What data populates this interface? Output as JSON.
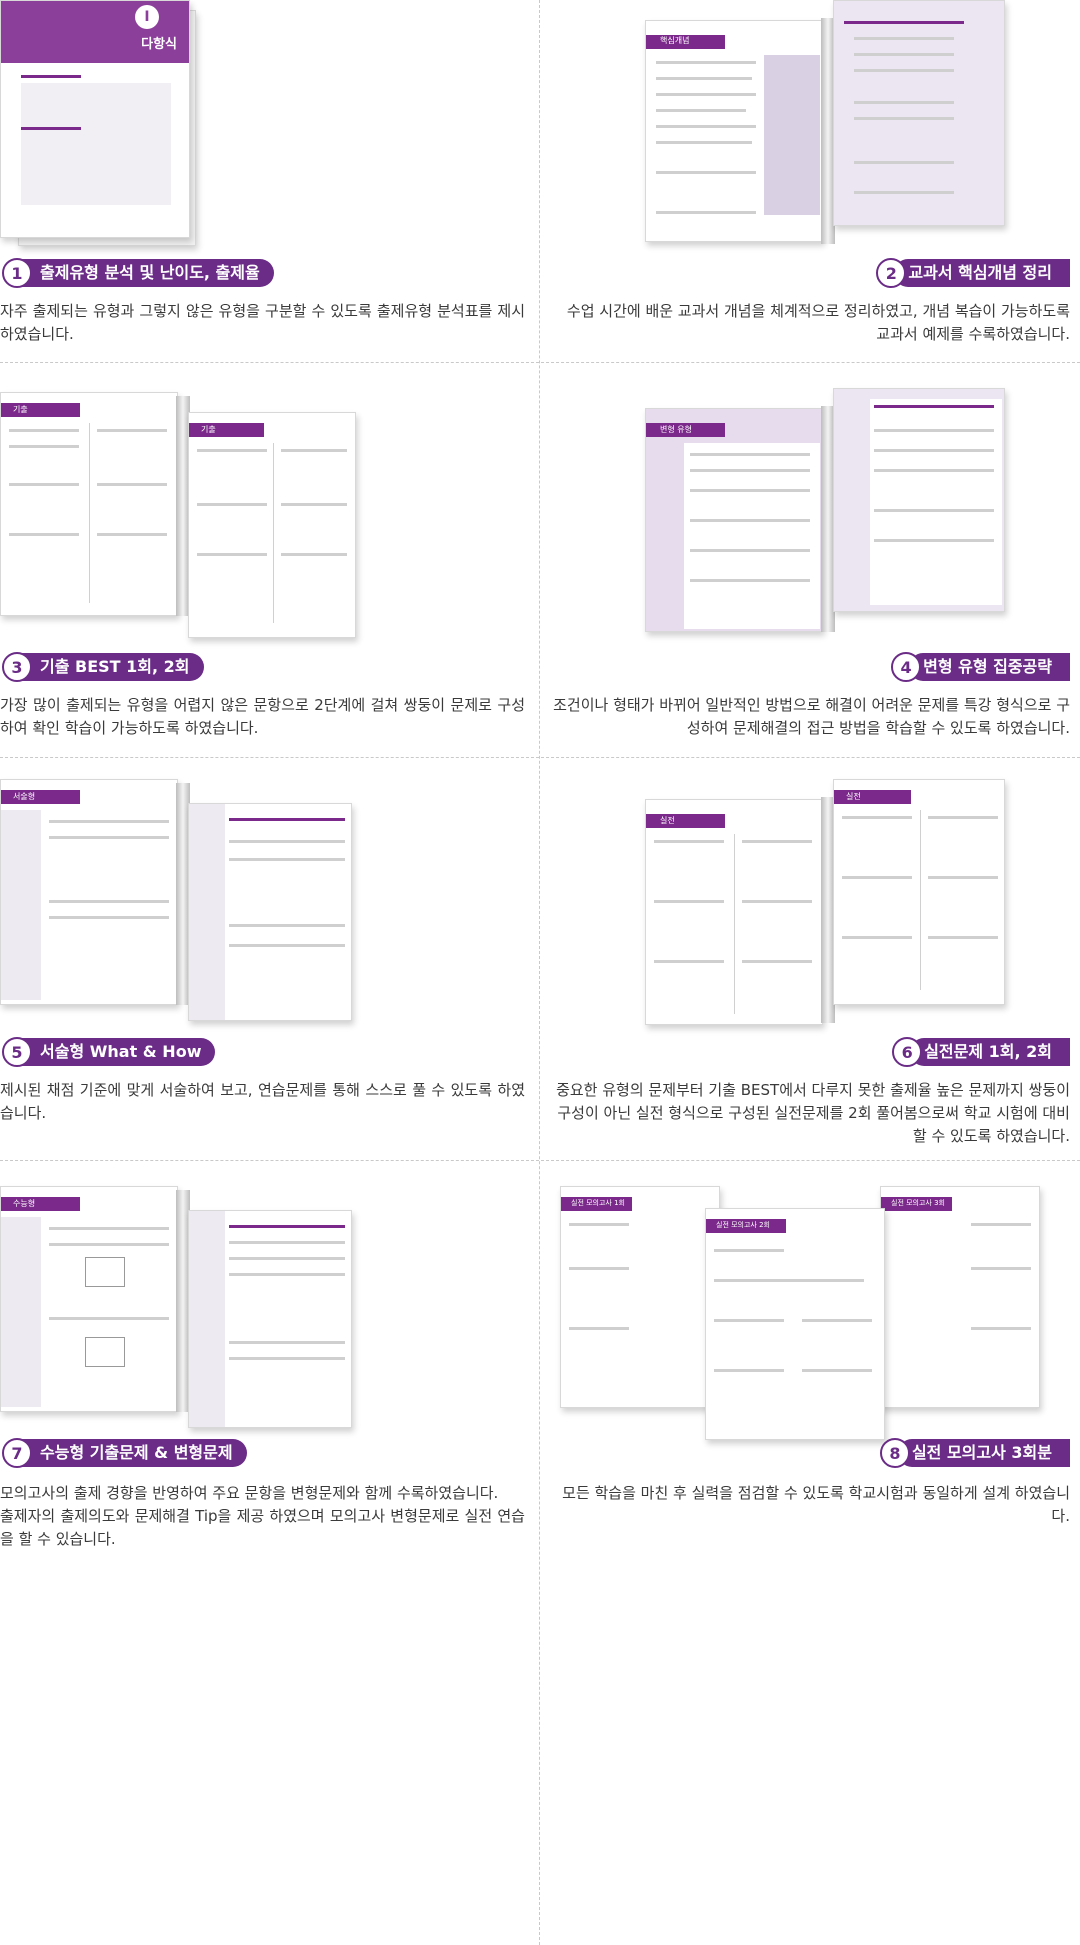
{
  "items": [
    {
      "num": "1",
      "title": "출제유형 분석 및 난이도, 출제율",
      "desc": [
        "자주 출제되는 유형과 그렇지 않은 유형을 구분할 수 있도록 출제유형 분석표를 제시하였습니다."
      ]
    },
    {
      "num": "2",
      "title": "교과서 핵심개념 정리",
      "desc": [
        "수업 시간에 배운 교과서 개념을 체계적으로 정리하였고, 개념 복습이 가능하도록 교과서 예제를 수록하였습니다."
      ]
    },
    {
      "num": "3",
      "title": "기출 BEST 1회, 2회",
      "desc": [
        "가장 많이 출제되는 유형을 어렵지 않은 문항으로 2단계에 걸쳐 쌍둥이 문제로 구성하여 확인 학습이 가능하도록 하였습니다."
      ]
    },
    {
      "num": "4",
      "title": "변형 유형 집중공략",
      "desc": [
        "조건이나 형태가 바뀌어 일반적인 방법으로 해결이 어려운 문제를 특강 형식으로 구성하여 문제해결의 접근 방법을 학습할 수 있도록 하였습니다."
      ]
    },
    {
      "num": "5",
      "title": "서술형 What & How",
      "desc": [
        "제시된 채점 기준에 맞게 서술하여 보고, 연습문제를 통해 스스로 풀 수 있도록 하였습니다."
      ]
    },
    {
      "num": "6",
      "title": "실전문제 1회, 2회",
      "desc": [
        "중요한 유형의 문제부터 기출 BEST에서 다루지 못한 출제율 높은 문제까지 쌍둥이 구성이 아닌 실전 형식으로 구성된 실전문제를 2회 풀어봄으로써 학교 시험에 대비할 수 있도록 하였습니다."
      ]
    },
    {
      "num": "7",
      "title": "수능형 기출문제 & 변형문제",
      "desc": [
        "모의고사의 출제 경향을 반영하여 주요 문항을 변형문제와 함께 수록하였습니다.",
        "출제자의 출제의도와 문제해결 Tip을 제공 하였으며 모의고사 변형문제로 실전 연습을 할 수 있습니다."
      ]
    },
    {
      "num": "8",
      "title": "실전 모의고사 3회분",
      "desc": [
        "모든 학습을 마친 후 실력을 점검할 수 있도록 학교시험과 동일하게 설계 하였습니다."
      ]
    }
  ],
  "thumbnails": {
    "cover_numeral": "I",
    "cover_title": "다항식",
    "concept_header": "핵심개념",
    "best1_header": "기출",
    "best2_header": "기출",
    "variant_header": "변형 유형",
    "essay_header": "서술형",
    "practice1_header": "실전",
    "practice2_header": "실전",
    "suneung_header": "수능형",
    "mock_headers": [
      "실전 모의고사 1회",
      "실전 모의고사 2회",
      "실전 모의고사 3회"
    ]
  },
  "colors": {
    "accent": "#6a2c86",
    "accent_light": "#8c3e9b",
    "lavender": "#ebe6f1"
  }
}
